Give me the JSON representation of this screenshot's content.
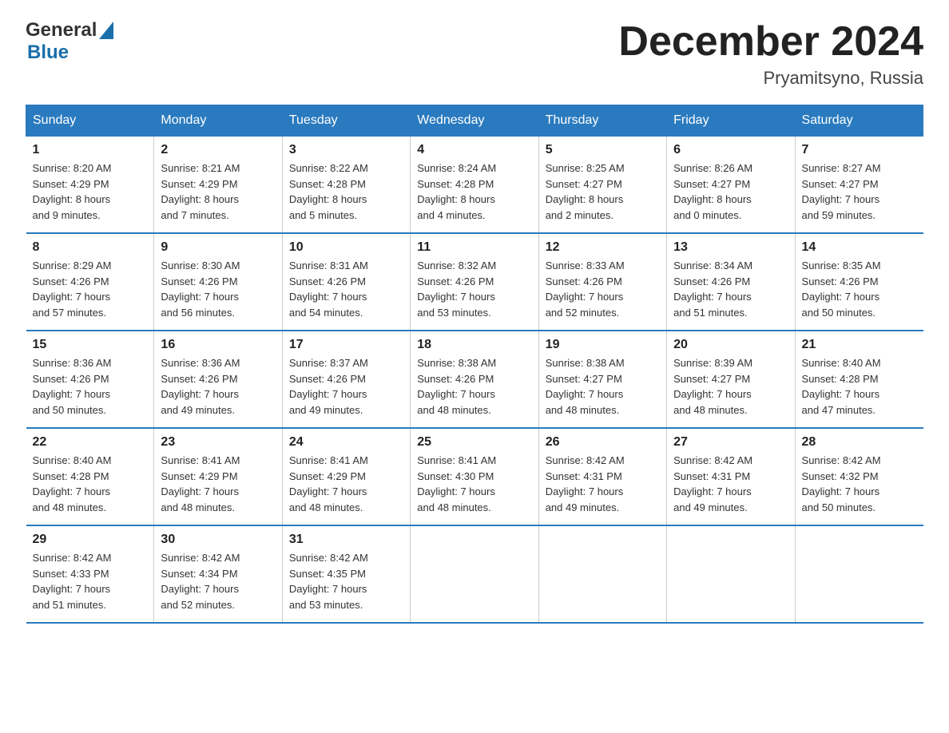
{
  "header": {
    "logo_general": "General",
    "logo_blue": "Blue",
    "title": "December 2024",
    "location": "Pryamitsyno, Russia"
  },
  "weekdays": [
    "Sunday",
    "Monday",
    "Tuesday",
    "Wednesday",
    "Thursday",
    "Friday",
    "Saturday"
  ],
  "weeks": [
    [
      {
        "day": "1",
        "info": "Sunrise: 8:20 AM\nSunset: 4:29 PM\nDaylight: 8 hours\nand 9 minutes."
      },
      {
        "day": "2",
        "info": "Sunrise: 8:21 AM\nSunset: 4:29 PM\nDaylight: 8 hours\nand 7 minutes."
      },
      {
        "day": "3",
        "info": "Sunrise: 8:22 AM\nSunset: 4:28 PM\nDaylight: 8 hours\nand 5 minutes."
      },
      {
        "day": "4",
        "info": "Sunrise: 8:24 AM\nSunset: 4:28 PM\nDaylight: 8 hours\nand 4 minutes."
      },
      {
        "day": "5",
        "info": "Sunrise: 8:25 AM\nSunset: 4:27 PM\nDaylight: 8 hours\nand 2 minutes."
      },
      {
        "day": "6",
        "info": "Sunrise: 8:26 AM\nSunset: 4:27 PM\nDaylight: 8 hours\nand 0 minutes."
      },
      {
        "day": "7",
        "info": "Sunrise: 8:27 AM\nSunset: 4:27 PM\nDaylight: 7 hours\nand 59 minutes."
      }
    ],
    [
      {
        "day": "8",
        "info": "Sunrise: 8:29 AM\nSunset: 4:26 PM\nDaylight: 7 hours\nand 57 minutes."
      },
      {
        "day": "9",
        "info": "Sunrise: 8:30 AM\nSunset: 4:26 PM\nDaylight: 7 hours\nand 56 minutes."
      },
      {
        "day": "10",
        "info": "Sunrise: 8:31 AM\nSunset: 4:26 PM\nDaylight: 7 hours\nand 54 minutes."
      },
      {
        "day": "11",
        "info": "Sunrise: 8:32 AM\nSunset: 4:26 PM\nDaylight: 7 hours\nand 53 minutes."
      },
      {
        "day": "12",
        "info": "Sunrise: 8:33 AM\nSunset: 4:26 PM\nDaylight: 7 hours\nand 52 minutes."
      },
      {
        "day": "13",
        "info": "Sunrise: 8:34 AM\nSunset: 4:26 PM\nDaylight: 7 hours\nand 51 minutes."
      },
      {
        "day": "14",
        "info": "Sunrise: 8:35 AM\nSunset: 4:26 PM\nDaylight: 7 hours\nand 50 minutes."
      }
    ],
    [
      {
        "day": "15",
        "info": "Sunrise: 8:36 AM\nSunset: 4:26 PM\nDaylight: 7 hours\nand 50 minutes."
      },
      {
        "day": "16",
        "info": "Sunrise: 8:36 AM\nSunset: 4:26 PM\nDaylight: 7 hours\nand 49 minutes."
      },
      {
        "day": "17",
        "info": "Sunrise: 8:37 AM\nSunset: 4:26 PM\nDaylight: 7 hours\nand 49 minutes."
      },
      {
        "day": "18",
        "info": "Sunrise: 8:38 AM\nSunset: 4:26 PM\nDaylight: 7 hours\nand 48 minutes."
      },
      {
        "day": "19",
        "info": "Sunrise: 8:38 AM\nSunset: 4:27 PM\nDaylight: 7 hours\nand 48 minutes."
      },
      {
        "day": "20",
        "info": "Sunrise: 8:39 AM\nSunset: 4:27 PM\nDaylight: 7 hours\nand 48 minutes."
      },
      {
        "day": "21",
        "info": "Sunrise: 8:40 AM\nSunset: 4:28 PM\nDaylight: 7 hours\nand 47 minutes."
      }
    ],
    [
      {
        "day": "22",
        "info": "Sunrise: 8:40 AM\nSunset: 4:28 PM\nDaylight: 7 hours\nand 48 minutes."
      },
      {
        "day": "23",
        "info": "Sunrise: 8:41 AM\nSunset: 4:29 PM\nDaylight: 7 hours\nand 48 minutes."
      },
      {
        "day": "24",
        "info": "Sunrise: 8:41 AM\nSunset: 4:29 PM\nDaylight: 7 hours\nand 48 minutes."
      },
      {
        "day": "25",
        "info": "Sunrise: 8:41 AM\nSunset: 4:30 PM\nDaylight: 7 hours\nand 48 minutes."
      },
      {
        "day": "26",
        "info": "Sunrise: 8:42 AM\nSunset: 4:31 PM\nDaylight: 7 hours\nand 49 minutes."
      },
      {
        "day": "27",
        "info": "Sunrise: 8:42 AM\nSunset: 4:31 PM\nDaylight: 7 hours\nand 49 minutes."
      },
      {
        "day": "28",
        "info": "Sunrise: 8:42 AM\nSunset: 4:32 PM\nDaylight: 7 hours\nand 50 minutes."
      }
    ],
    [
      {
        "day": "29",
        "info": "Sunrise: 8:42 AM\nSunset: 4:33 PM\nDaylight: 7 hours\nand 51 minutes."
      },
      {
        "day": "30",
        "info": "Sunrise: 8:42 AM\nSunset: 4:34 PM\nDaylight: 7 hours\nand 52 minutes."
      },
      {
        "day": "31",
        "info": "Sunrise: 8:42 AM\nSunset: 4:35 PM\nDaylight: 7 hours\nand 53 minutes."
      },
      {
        "day": "",
        "info": ""
      },
      {
        "day": "",
        "info": ""
      },
      {
        "day": "",
        "info": ""
      },
      {
        "day": "",
        "info": ""
      }
    ]
  ]
}
